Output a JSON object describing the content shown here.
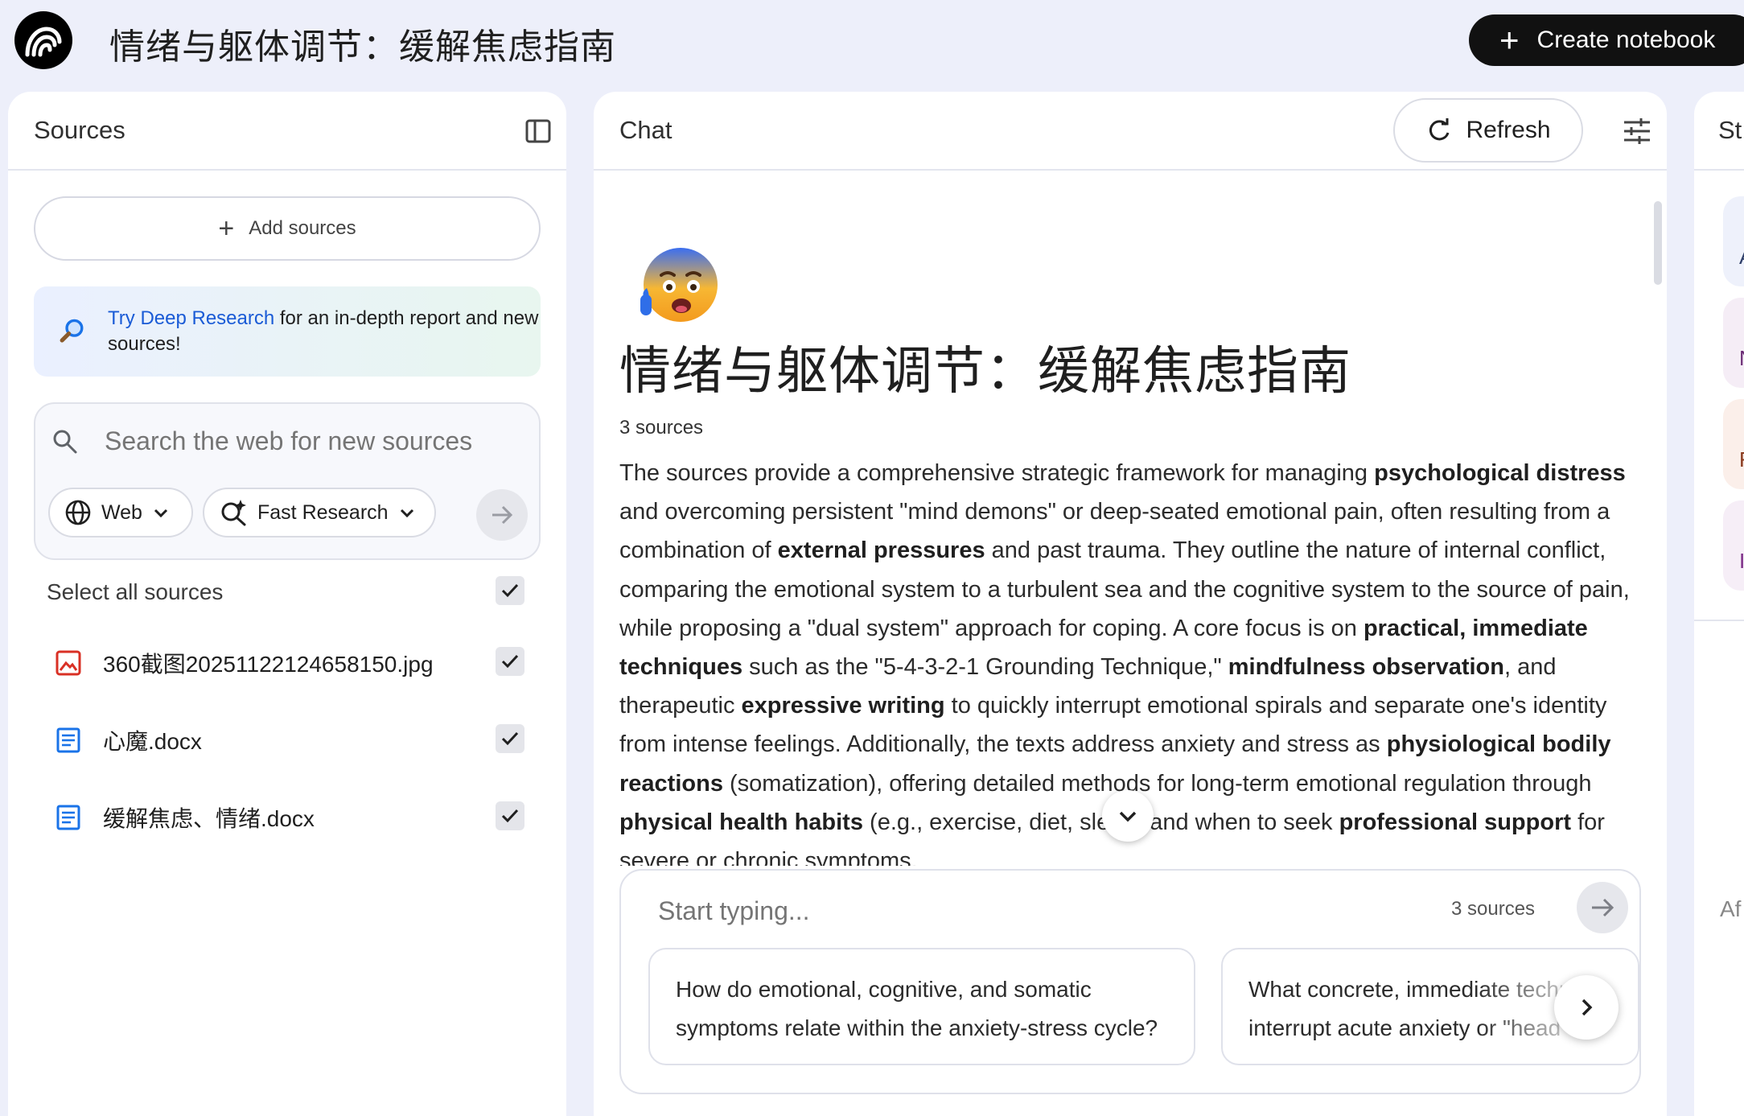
{
  "app": {
    "title": "情绪与躯体调节：缓解焦虑指南",
    "create_notebook_label": "Create notebook"
  },
  "sources_panel": {
    "title": "Sources",
    "add_sources_label": "Add sources",
    "deep_research": {
      "link_text": "Try Deep Research",
      "rest_text": " for an in-depth report and new sources!"
    },
    "search": {
      "placeholder": "Search the web for new sources",
      "source_type": "Web",
      "research_mode": "Fast Research"
    },
    "select_all_label": "Select all sources",
    "items": [
      {
        "name": "360截图20251122124658150.jpg",
        "type": "image",
        "checked": true
      },
      {
        "name": "心魔.docx",
        "type": "document",
        "checked": true
      },
      {
        "name": "缓解焦虑、情绪.docx",
        "type": "document",
        "checked": true
      }
    ]
  },
  "chat_panel": {
    "title": "Chat",
    "refresh_label": "Refresh",
    "notebook_emoji": "anxious-face-with-sweat",
    "notebook_title": "情绪与躯体调节：缓解焦虑指南",
    "source_count": "3 sources",
    "summary": {
      "t01": "The sources provide a comprehensive strategic framework for managing ",
      "b01": "psychological distress",
      "t02": " and overcoming persistent \"mind demons\" or deep-seated emotional pain, often resulting from a combination of ",
      "b02": "external pressures",
      "t03": " and past trauma. They outline the nature of internal conflict, comparing the emotional system to a turbulent sea and the cognitive system to the source of pain, while proposing a \"dual system\" approach for coping. A core focus is on ",
      "b03": "practical, immediate techniques",
      "t04": " such as the \"5-4-3-2-1 Grounding Technique,\" ",
      "b04": "mindfulness observation",
      "t05": ", and therapeutic ",
      "b05": "expressive writing",
      "t06": " to quickly interrupt emotional spirals and separate one's identity from intense feelings. Additionally, the texts address anxiety and stress as ",
      "b06": "physiological bodily reactions",
      "t07": " (somatization), offering detailed methods for long-term emotional regulation through ",
      "b07": "physical health habits",
      "t08": " (e.g., exercise, diet, sleep) and when to seek ",
      "b08": "professional support",
      "t09": " for severe or chronic symptoms."
    },
    "composer": {
      "placeholder": "Start typing...",
      "source_count": "3 sources"
    },
    "suggestions": [
      "How do emotional, cognitive, and somatic symptoms relate within the anxiety-stress cycle?",
      "What concrete, immediate techniques help to interrupt acute anxiety or \"head"
    ]
  },
  "studio_panel": {
    "title_fragment": "St",
    "tile_fragments": [
      "A",
      "N",
      "F",
      "I"
    ],
    "bottom_fragment": "Af"
  },
  "colors": {
    "page_bg": "#edeffa",
    "accent_link": "#1a5bd6",
    "create_button_bg": "#111111",
    "image_file_icon": "#d93025",
    "doc_file_icon": "#1a73e8"
  }
}
